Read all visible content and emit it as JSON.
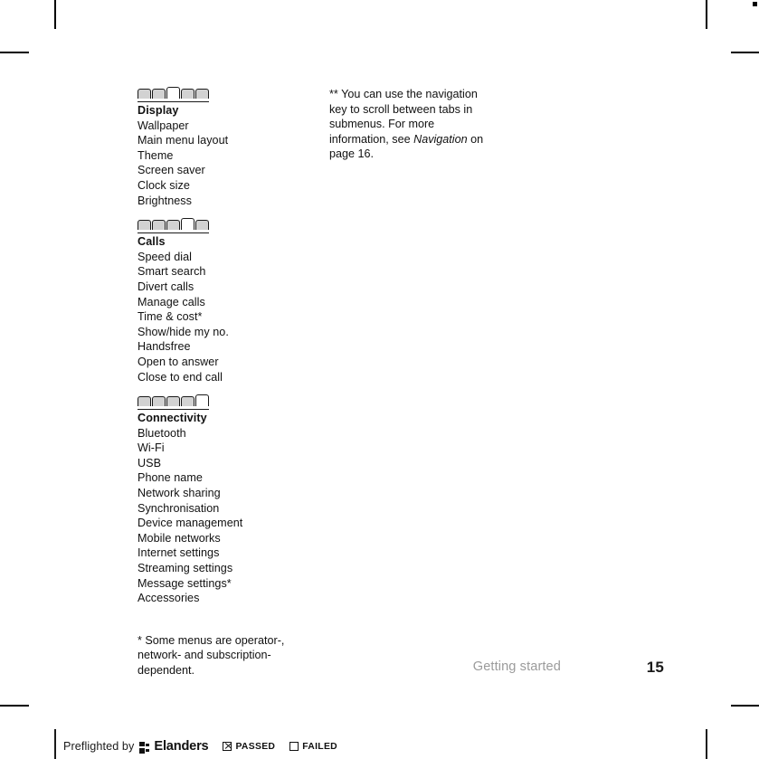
{
  "page": {
    "section_label": "Getting started",
    "page_number": "15"
  },
  "left_column": {
    "groups": [
      {
        "tabs": {
          "count": 5,
          "selected_index": 2
        },
        "title": "Display",
        "items": [
          "Wallpaper",
          "Main menu layout",
          "Theme",
          "Screen saver",
          "Clock size",
          "Brightness"
        ]
      },
      {
        "tabs": {
          "count": 5,
          "selected_index": 3
        },
        "title": "Calls",
        "items": [
          "Speed dial",
          "Smart search",
          "Divert calls",
          "Manage calls",
          "Time & cost*",
          "Show/hide my no.",
          "Handsfree",
          "Open to answer",
          "Close to end call"
        ]
      },
      {
        "tabs": {
          "count": 5,
          "selected_index": 4
        },
        "title": "Connectivity",
        "items": [
          "Bluetooth",
          "Wi-Fi",
          "USB",
          "Phone name",
          "Network sharing",
          "Synchronisation",
          "Device management",
          "Mobile networks",
          "Internet settings",
          "Streaming settings",
          "Message settings*",
          "Accessories"
        ]
      }
    ],
    "footnote": "* Some menus are operator-, network- and subscription-dependent."
  },
  "right_column": {
    "note_part1": "** You can use the navigation key to scroll between tabs in submenus. For more information, see ",
    "note_italic": "Navigation",
    "note_part2": " on page 16."
  },
  "preflight": {
    "prefix": "Preflighted by",
    "brand": "Elanders",
    "passed_label": "PASSED",
    "failed_label": "FAILED",
    "passed_checked": true,
    "failed_checked": false
  },
  "colors": {
    "text": "#111111",
    "muted": "#9b9b9b",
    "tab_fill": "#d2d2d2",
    "tab_selected_fill": "#ffffff",
    "rule": "#1a1a1a"
  }
}
